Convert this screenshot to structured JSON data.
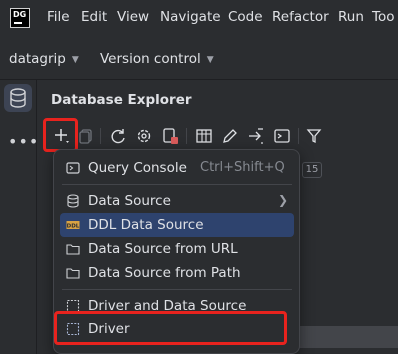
{
  "app": {
    "logo_text": "DG",
    "menu": [
      "File",
      "Edit",
      "View",
      "Navigate",
      "Code",
      "Refactor",
      "Run",
      "Too"
    ]
  },
  "project_bar": {
    "project_name": "datagrip",
    "vcs_label": "Version control"
  },
  "panel": {
    "title": "Database Explorer",
    "tree_badge": "15"
  },
  "new_menu": {
    "items": [
      {
        "label": "Query Console",
        "shortcut": "Ctrl+Shift+Q",
        "icon": "console-icon"
      },
      {
        "label": "Data Source",
        "icon": "datasource-icon",
        "has_submenu": true
      },
      {
        "label": "DDL Data Source",
        "icon": "ddl-icon",
        "selected": true
      },
      {
        "label": "Data Source from URL",
        "icon": "folder-icon"
      },
      {
        "label": "Data Source from Path",
        "icon": "folder-icon"
      },
      {
        "label": "Driver and Data Source",
        "icon": "driver-icon"
      },
      {
        "label": "Driver",
        "icon": "driver-icon"
      }
    ]
  },
  "colors": {
    "highlight": "#e8231e",
    "selection": "#2e436e",
    "background": "#2b2d30"
  }
}
